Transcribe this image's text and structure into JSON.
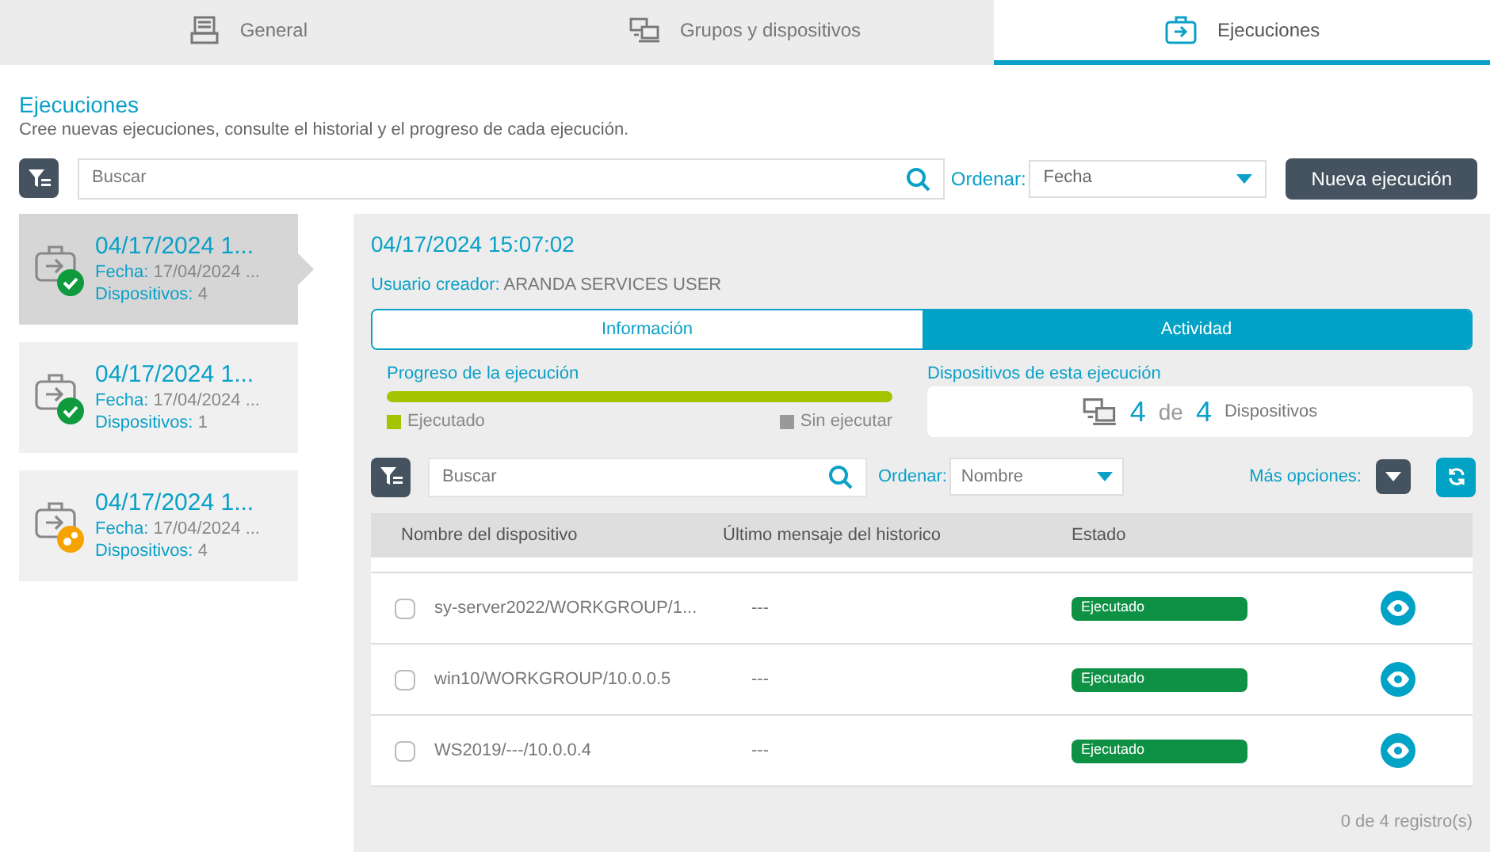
{
  "tabs": [
    {
      "label": "General",
      "selected": false
    },
    {
      "label": "Grupos y dispositivos",
      "selected": false
    },
    {
      "label": "Ejecuciones",
      "selected": true
    }
  ],
  "header": {
    "title": "Ejecuciones",
    "subtitle": "Cree nuevas ejecuciones, consulte el historial y el progreso de cada ejecución."
  },
  "toolbar": {
    "search_placeholder": "Buscar",
    "sort_label": "Ordenar:",
    "sort_value": "Fecha",
    "new_button": "Nueva ejecución"
  },
  "executions": [
    {
      "title": "04/17/2024 1...",
      "date_label": "Fecha:",
      "date": "17/04/2024 ...",
      "devices_label": "Dispositivos:",
      "devices": "4",
      "kind": "done",
      "selected": true
    },
    {
      "title": "04/17/2024 1...",
      "date_label": "Fecha:",
      "date": "17/04/2024 ...",
      "devices_label": "Dispositivos:",
      "devices": "1",
      "kind": "done",
      "selected": false
    },
    {
      "title": "04/17/2024 1...",
      "date_label": "Fecha:",
      "date": "17/04/2024 ...",
      "devices_label": "Dispositivos:",
      "devices": "4",
      "kind": "running",
      "selected": false
    }
  ],
  "detail": {
    "title": "04/17/2024 15:07:02",
    "creator_label": "Usuario creador:",
    "creator": "ARANDA SERVICES USER",
    "tabs": [
      {
        "label": "Información",
        "selected": false
      },
      {
        "label": "Actividad",
        "selected": true
      }
    ],
    "progress": {
      "label": "Progreso de la ejecución",
      "level": 1,
      "legend_done": "Ejecutado",
      "legend_pending": "Sin ejecutar"
    },
    "devices_box": {
      "label": "Dispositivos de esta ejecución",
      "done": "4",
      "of": "de",
      "total": "4",
      "unit": "Dispositivos"
    },
    "search_placeholder": "Buscar",
    "sort_label": "Ordenar:",
    "sort_value": "Nombre",
    "more_label": "Más opciones:",
    "table": {
      "columns": [
        "Nombre del dispositivo",
        "Último mensaje del historico",
        "Estado"
      ],
      "rows": [
        {
          "name": "sy-server2022/WORKGROUP/1...",
          "message": "---",
          "status": "Ejecutado",
          "checked": false
        },
        {
          "name": "win10/WORKGROUP/10.0.0.5",
          "message": "---",
          "status": "Ejecutado",
          "checked": false
        },
        {
          "name": "WS2019/---/10.0.0.4",
          "message": "---",
          "status": "Ejecutado",
          "checked": false
        }
      ]
    },
    "footer": "0 de 4 registro(s)"
  }
}
